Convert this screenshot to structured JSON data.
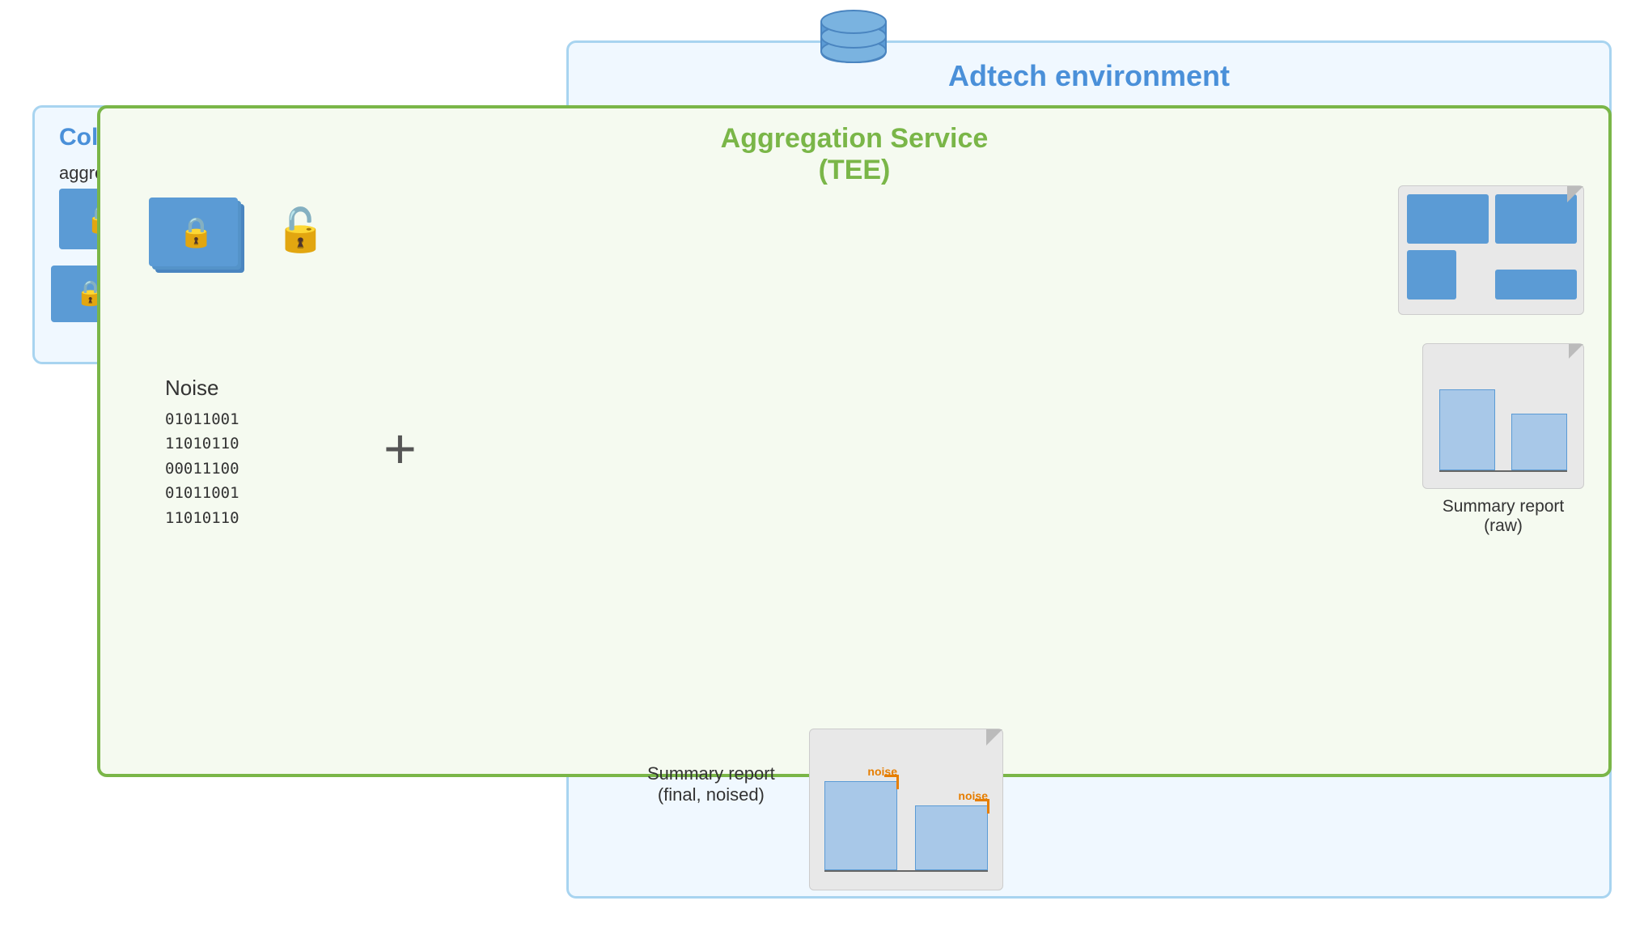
{
  "adtech": {
    "label": "Adtech environment"
  },
  "collection": {
    "label": "Collection service",
    "sublabel": "aggregatable reports"
  },
  "aggregation": {
    "label": "Aggregation Service",
    "sublabel": "(TEE)"
  },
  "noise": {
    "label": "Noise",
    "binary_lines": [
      "01011001",
      "11010110",
      "00011100",
      "01011001",
      "11010110"
    ]
  },
  "summary_raw": {
    "label": "Summary report",
    "sublabel": "(raw)"
  },
  "summary_final": {
    "label": "Summary report",
    "sublabel": "(final, noised)"
  },
  "noise_label": "noise"
}
